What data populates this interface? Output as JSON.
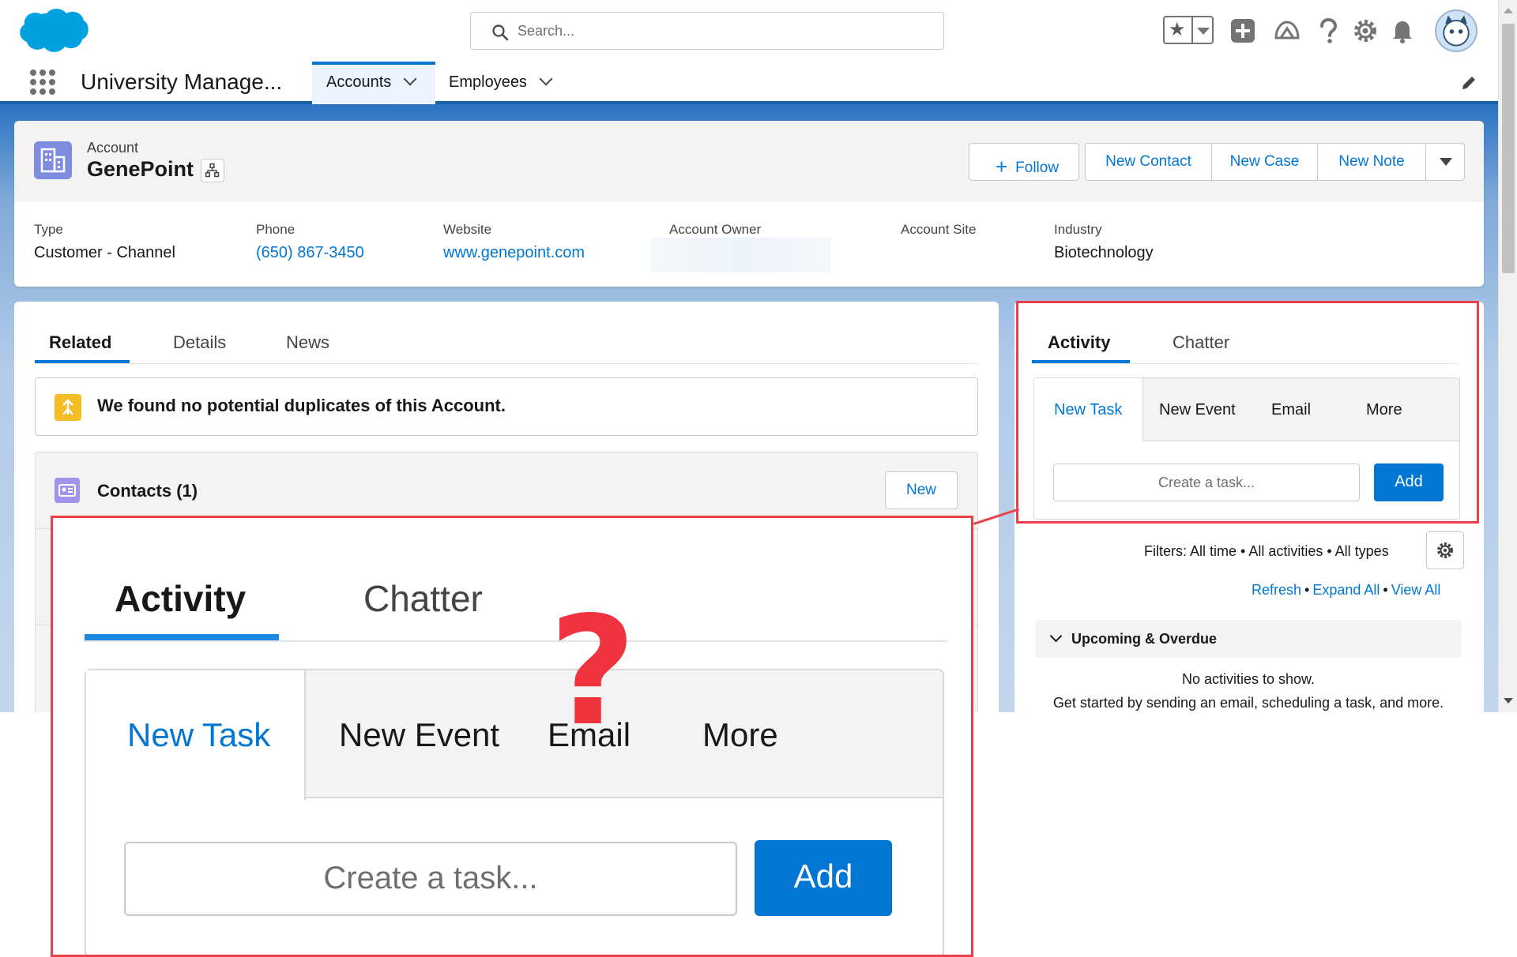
{
  "header": {
    "search_placeholder": "Search...",
    "icons": [
      "star-icon",
      "add-icon",
      "trailhead-icon",
      "help-icon",
      "setup-gear-icon",
      "notification-bell-icon",
      "user-avatar"
    ]
  },
  "nav": {
    "app_name": "University Manage...",
    "tabs": [
      {
        "label": "Accounts",
        "active": true
      },
      {
        "label": "Employees",
        "active": false
      }
    ]
  },
  "record": {
    "object_label": "Account",
    "name": "GenePoint",
    "actions": {
      "follow": "Follow",
      "new_contact": "New Contact",
      "new_case": "New Case",
      "new_note": "New Note"
    },
    "fields": {
      "type": {
        "label": "Type",
        "value": "Customer - Channel"
      },
      "phone": {
        "label": "Phone",
        "value": "(650) 867-3450"
      },
      "website": {
        "label": "Website",
        "value": "www.genepoint.com"
      },
      "owner": {
        "label": "Account Owner",
        "value": ""
      },
      "site": {
        "label": "Account Site",
        "value": ""
      },
      "industry": {
        "label": "Industry",
        "value": "Biotechnology"
      }
    }
  },
  "main": {
    "tabs": [
      "Related",
      "Details",
      "News"
    ],
    "duplicates_text": "We found no potential duplicates of this Account.",
    "contacts_title": "Contacts (1)",
    "contacts_new": "New"
  },
  "activity": {
    "tabs": [
      "Activity",
      "Chatter"
    ],
    "composer_tabs": [
      "New Task",
      "New Event",
      "Email",
      "More"
    ],
    "task_placeholder": "Create a task...",
    "add_label": "Add",
    "filters": "Filters: All time • All activities • All types",
    "links": [
      "Refresh",
      "Expand All",
      "View All"
    ],
    "link_sep": "•",
    "upcoming": "Upcoming & Overdue",
    "no_activities": "No activities to show.",
    "get_started": "Get started by sending an email, scheduling a task, and more."
  },
  "callout": {
    "question_mark": "?"
  },
  "colors": {
    "brand_blue": "#0176d3",
    "highlight_red": "#e8414b",
    "account_icon": "#7f8de1",
    "contacts_icon": "#a094ed",
    "duplicate_icon": "#f4bc25"
  }
}
